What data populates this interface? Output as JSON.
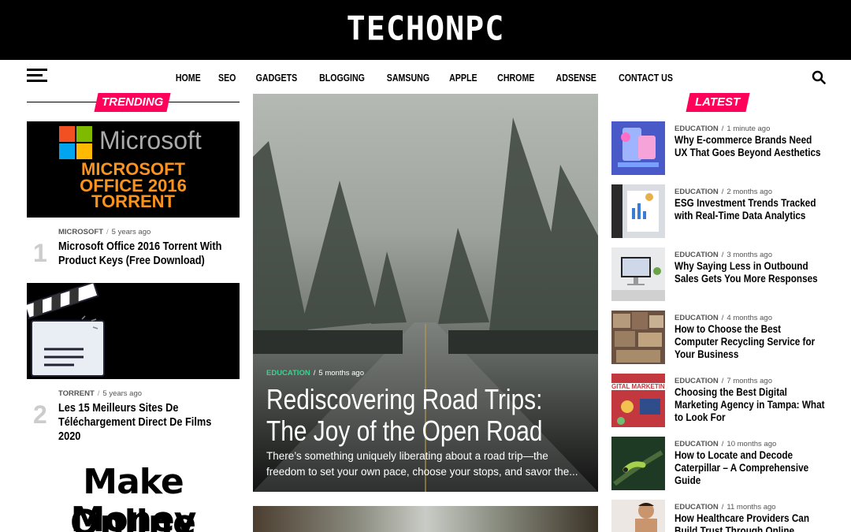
{
  "site": {
    "logo": "TECHONPC"
  },
  "nav": {
    "items": [
      "HOME",
      "SEO",
      "GADGETS",
      "BLOGGING",
      "SAMSUNG",
      "APPLE",
      "CHROME",
      "ADSENSE",
      "CONTACT US"
    ]
  },
  "trending": {
    "heading": "TRENDING",
    "posts": [
      {
        "num": "1",
        "category": "MICROSOFT",
        "time": "5 years ago",
        "title": "Microsoft Office 2016 Torrent With Product Keys (Free Download)",
        "image": {
          "brand": "Microsoft",
          "line1": "MICROSOFT",
          "line2": "OFFICE 2016",
          "line3": "TORRENT"
        }
      },
      {
        "num": "2",
        "category": "TORRENT",
        "time": "5 years ago",
        "title": "Les 15 Meilleurs Sites De Téléchargement Direct De Films 2020",
        "image": {
          "icon": "clapperboard-icon"
        }
      }
    ],
    "third_image": {
      "line1": "Make Money",
      "line2": "Online"
    }
  },
  "feature": {
    "category": "EDUCATION",
    "time": "5 months ago",
    "title": "Rediscovering Road Trips: The Joy of the Open Road",
    "excerpt": "There’s something uniquely liberating about a road trip—the freedom to set your own pace, choose your stops, and savor the..."
  },
  "latest": {
    "heading": "LATEST",
    "posts": [
      {
        "category": "EDUCATION",
        "time": "1 minute ago",
        "title": "Why E-commerce Brands Need UX That Goes Beyond Aesthetics",
        "thumb_color": "#4a59c8"
      },
      {
        "category": "EDUCATION",
        "time": "2 months ago",
        "title": "ESG Investment Trends Tracked with Real-Time Data Analytics",
        "thumb_color": "#d9dde2"
      },
      {
        "category": "EDUCATION",
        "time": "3 months ago",
        "title": "Why Saying Less in Outbound Sales Gets You More Responses",
        "thumb_color": "#e9eaeb"
      },
      {
        "category": "EDUCATION",
        "time": "4 months ago",
        "title": "How to Choose the Best Computer Recycling Service for Your Business",
        "thumb_color": "#6b5141"
      },
      {
        "category": "EDUCATION",
        "time": "7 months ago",
        "title": "Choosing the Best Digital Marketing Agency in Tampa: What to Look For",
        "thumb_color": "#c2383e",
        "thumb_text": "GITAL MARKETING"
      },
      {
        "category": "EDUCATION",
        "time": "10 months ago",
        "title": "How to Locate and Decode Caterpillar – A Comprehensive Guide",
        "thumb_color": "#1f3a24"
      },
      {
        "category": "EDUCATION",
        "time": "11 months ago",
        "title": "How Healthcare Providers Can Build Trust Through Online Reviews",
        "thumb_color": "#d8c6b4"
      }
    ]
  },
  "colors": {
    "accent": "#ff005b",
    "feature_category": "#3ad28f",
    "header_bg": "#000000"
  }
}
